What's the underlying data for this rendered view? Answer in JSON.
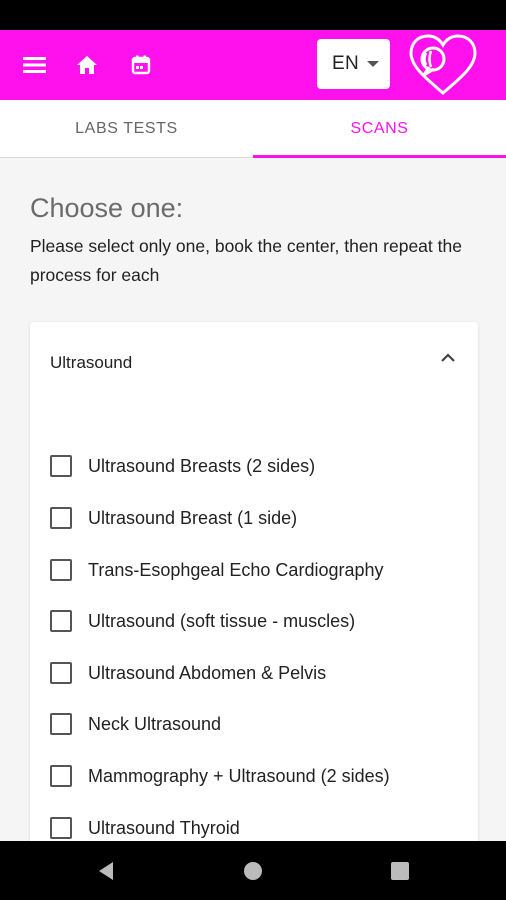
{
  "app_bar": {
    "background": "#ff11ee",
    "icons": [
      "menu-icon",
      "home-icon",
      "calendar-icon"
    ],
    "language": "EN"
  },
  "tabs": [
    {
      "label": "LABS TESTS",
      "active": false
    },
    {
      "label": "SCANS",
      "active": true
    }
  ],
  "main": {
    "heading": "Choose one:",
    "instructions": "Please select only one, book the center, then repeat the process for each"
  },
  "category": {
    "title": "Ultrasound",
    "expanded": true,
    "items": [
      {
        "label": "Ultrasound Breasts (2 sides)",
        "checked": false
      },
      {
        "label": "Ultrasound Breast (1 side)",
        "checked": false
      },
      {
        "label": "Trans-Esophgeal Echo Cardiography",
        "checked": false
      },
      {
        "label": "Ultrasound (soft tissue - muscles)",
        "checked": false
      },
      {
        "label": "Ultrasound Abdomen & Pelvis",
        "checked": false
      },
      {
        "label": "Neck Ultrasound",
        "checked": false
      },
      {
        "label": "Mammography + Ultrasound (2 sides)",
        "checked": false
      },
      {
        "label": "Ultrasound Thyroid",
        "checked": false
      }
    ]
  },
  "nav_bar": {
    "icons": [
      "back-icon",
      "home-circle-icon",
      "recents-icon"
    ]
  }
}
